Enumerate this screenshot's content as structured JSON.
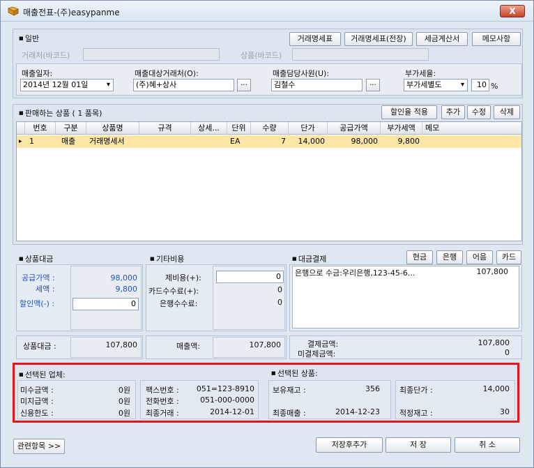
{
  "window": {
    "title": "매출전표-(주)easypanme",
    "close_label": "X"
  },
  "general": {
    "section": "일반",
    "buttons": [
      "거래명세표",
      "거래명세표(전장)",
      "세금계산서",
      "메모사항"
    ],
    "barcode_client_label": "거래처(바코드)",
    "barcode_product_label": "상품(바코드)",
    "sale_date_label": "매출일자:",
    "sale_date_value": "2014년 12월 01일",
    "client_label": "매출대상거래처(O):",
    "client_value": "(주)혜+상사",
    "staff_label": "매출담당사원(U):",
    "staff_value": "김철수",
    "vat_label": "부가세율:",
    "vat_value": "부가세별도",
    "vat_rate": "10",
    "vat_unit": "%",
    "ellipsis": "..."
  },
  "products": {
    "section": "판매하는 상품 ( 1 품목)",
    "buttons": [
      "할인율 적용",
      "추가",
      "수정",
      "삭제"
    ],
    "columns": [
      "번호",
      "구분",
      "상품명",
      "규격",
      "상세...",
      "단위",
      "수량",
      "단가",
      "공급가액",
      "부가세액",
      "메모"
    ],
    "rows": [
      {
        "marker": "▸",
        "no": "1",
        "type": "매출",
        "name": "거래명세서",
        "spec": "",
        "detail": "",
        "unit": "EA",
        "qty": "7",
        "price": "14,000",
        "supply": "98,000",
        "vat": "9,800",
        "memo": ""
      }
    ]
  },
  "amount": {
    "section": "상품대금",
    "supply_label": "공급가액 :",
    "supply_value": "98,000",
    "tax_label": "세액 :",
    "tax_value": "9,800",
    "discount_label": "할인액(-) :",
    "discount_value": "0",
    "total_label": "상품대금 :",
    "total_value": "107,800"
  },
  "other": {
    "section": "기타비용",
    "misc_label": "제비용(+):",
    "misc_value": "0",
    "card_label": "카드수수료(+):",
    "card_value": "0",
    "bank_label": "은행수수료:",
    "bank_value": "0",
    "sales_label": "매출액:",
    "sales_value": "107,800"
  },
  "payment": {
    "section": "대금결제",
    "buttons": [
      "현금",
      "은행",
      "어음",
      "카드"
    ],
    "entry_text": "은행으로 수금:우리은행,123-45-6...",
    "entry_amount": "107,800",
    "paid_label": "결제금액:",
    "paid_value": "107,800",
    "unpaid_label": "미결제금액:",
    "unpaid_value": "0"
  },
  "selected_company": {
    "section": "선택된 업체:",
    "receivable_label": "미수금액 :",
    "receivable_value": "0원",
    "payable_label": "미지급액 :",
    "payable_value": "0원",
    "credit_label": "신용한도 :",
    "credit_value": "0원",
    "fax_label": "팩스번호 :",
    "fax_value": "051=123-8910",
    "phone_label": "전화번호 :",
    "phone_value": "051-000-0000",
    "last_label": "최종거래 :",
    "last_value": "2014-12-01"
  },
  "selected_product": {
    "section": "선택된 상품:",
    "stock_label": "보유재고 :",
    "stock_value": "356",
    "last_price_label": "최종단가 :",
    "last_price_value": "14,000",
    "last_sale_label": "최종매출 :",
    "last_sale_value": "2014-12-23",
    "proper_stock_label": "적정재고 :",
    "proper_stock_value": "30"
  },
  "footer": {
    "related_label": "관련항목 >>",
    "save_add_label": "저장후추가",
    "save_label": "저 장",
    "cancel_label": "취 소"
  }
}
